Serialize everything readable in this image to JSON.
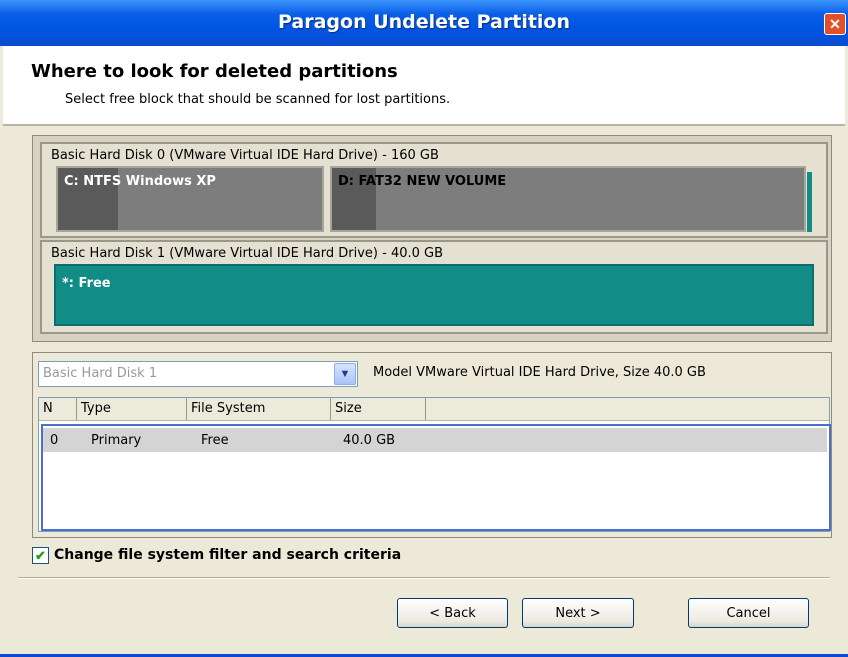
{
  "window": {
    "title": "Paragon Undelete Partition",
    "close_symbol": "✕"
  },
  "header": {
    "title": "Where to look for deleted partitions",
    "subtitle": "Select free block that should be scanned for lost partitions."
  },
  "disk_map": {
    "disks": [
      {
        "label": "Basic Hard Disk 0 (VMware Virtual IDE Hard Drive) - 160 GB",
        "partitions": [
          {
            "label": "C: NTFS Windows XP",
            "used_fraction": 0.23
          },
          {
            "label": "D: FAT32 NEW VOLUME",
            "used_fraction": 0.09
          }
        ]
      },
      {
        "label": "Basic Hard Disk 1 (VMware Virtual IDE Hard Drive) - 40.0 GB",
        "partitions": [
          {
            "label": "*: Free",
            "selected": true
          }
        ]
      }
    ]
  },
  "details": {
    "disk_select": {
      "value": "Basic Hard Disk 1",
      "disabled": true
    },
    "model_text": "Model VMware Virtual IDE Hard Drive, Size 40.0 GB",
    "table": {
      "headers": [
        "N",
        "Type",
        "File System",
        "Size"
      ],
      "rows": [
        {
          "n": "0",
          "type": "Primary",
          "fs": "Free",
          "size": "40.0 GB"
        }
      ]
    }
  },
  "filter_checkbox": {
    "label": "Change file system filter and search criteria",
    "checked": true,
    "mark": "✔"
  },
  "buttons": {
    "back": "< Back",
    "next": "Next >",
    "cancel": "Cancel"
  },
  "colors": {
    "title_bar": "#0055e5",
    "free_block": "#128c86",
    "used_space": "#5a5a5a",
    "partition": "#7d7d7d"
  }
}
